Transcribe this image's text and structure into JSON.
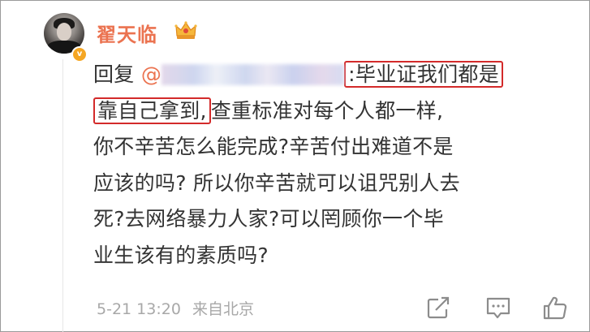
{
  "post": {
    "username": "翟天临",
    "badge": "v",
    "reply_prefix": "回复",
    "mention": "@",
    "lines": [
      {
        "before": "",
        "highlight": ":毕业证我们都是"
      },
      {
        "highlight": "靠自己拿到,",
        "after": "查重标准对每个人都一样,"
      },
      {
        "text": "你不辛苦怎么能完成?辛苦付出难道不是"
      },
      {
        "text": "应该的吗? 所以你辛苦就可以诅咒别人去"
      },
      {
        "text": "死?去网络暴力人家?可以罔顾你一个毕"
      },
      {
        "text": "业生该有的素质吗?"
      }
    ],
    "timestamp": "5-21 13:20",
    "source": "来自北京"
  },
  "icons": {
    "crown": "crown-vip-icon",
    "share": "share-icon",
    "comment": "comment-icon",
    "like": "like-icon"
  },
  "colors": {
    "username": "#eb7350",
    "highlight_border": "#d32a2a",
    "text": "#333333",
    "meta": "#a8a8a8"
  }
}
